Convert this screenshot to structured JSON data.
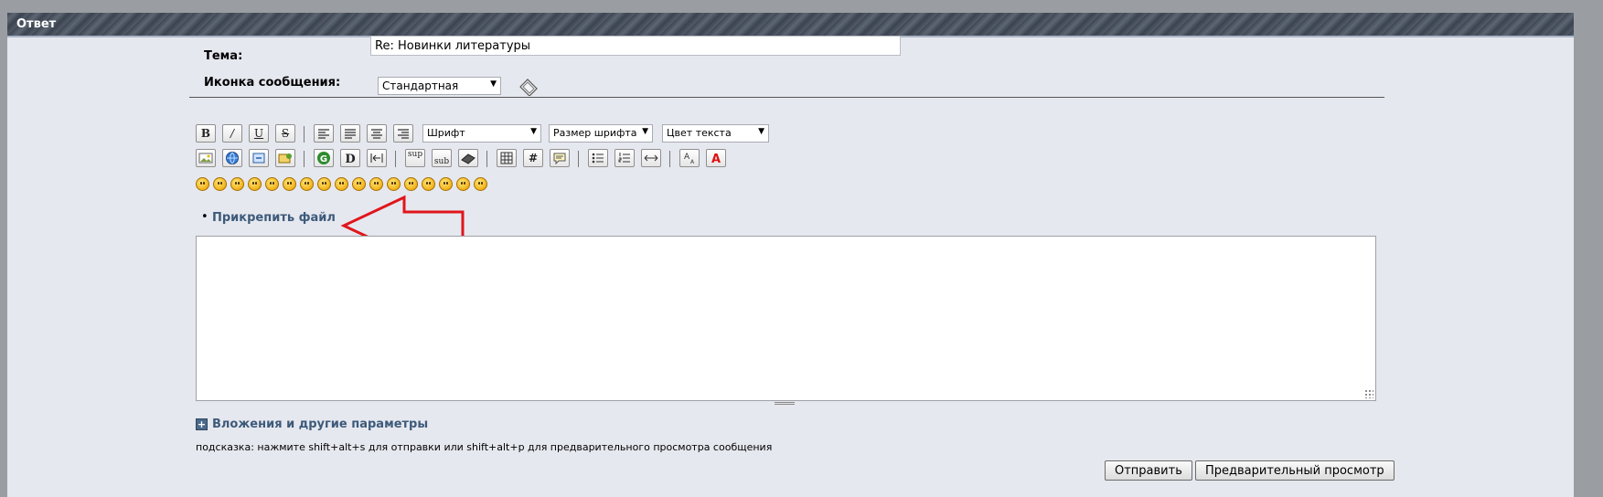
{
  "header": {
    "title": "Ответ"
  },
  "form": {
    "subject_label": "Тема:",
    "subject_value": "Re: Новинки литературы",
    "icon_label": "Иконка сообщения:",
    "icon_select": "Стандартная"
  },
  "toolbar": {
    "font_select": "Шрифт",
    "size_select": "Размер шрифта",
    "color_select": "Цвет текста",
    "buttons_row1": [
      "bold",
      "italic",
      "underline",
      "strikethrough",
      "align-left",
      "align-center-left",
      "align-center",
      "align-right"
    ],
    "buttons_row2": [
      "image",
      "link",
      "unlink",
      "email",
      "google",
      "youtube",
      "indent",
      "sup",
      "sub",
      "code",
      "table",
      "hash",
      "quote",
      "bulleted-list",
      "numbered-list",
      "horizontal-rule",
      "font-size",
      "text-color"
    ],
    "sup_label": "sup",
    "sub_label": "sub",
    "smiley_count": 17
  },
  "attach": {
    "label": "Прикрепить файл"
  },
  "options": {
    "label": "Вложения и другие параметры"
  },
  "hint": "подсказка: нажмите shift+alt+s для отправки или shift+alt+p для предварительного просмотра сообщения",
  "buttons": {
    "submit": "Отправить",
    "preview": "Предварительный просмотр"
  },
  "colors": {
    "accent_link": "#3d5a7a",
    "annotation_arrow": "#e0161c"
  }
}
